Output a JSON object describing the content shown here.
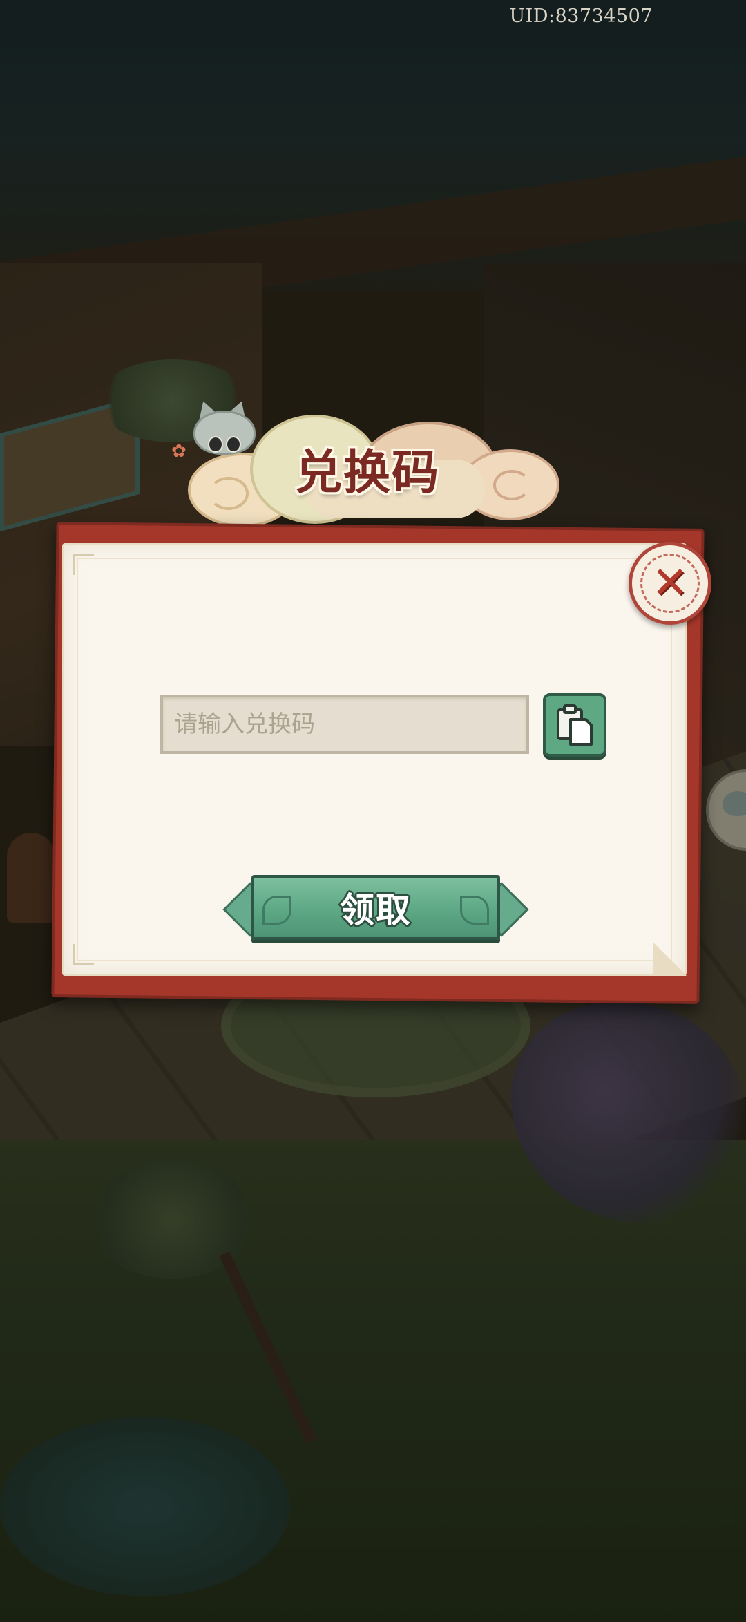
{
  "header": {
    "uid": "UID:83734507"
  },
  "dialog": {
    "title": "兑换码",
    "close_icon": "close-icon",
    "code_input": {
      "placeholder": "请输入兑换码",
      "value": ""
    },
    "paste_icon": "clipboard-paste-icon",
    "claim_button_label": "领取"
  },
  "colors": {
    "frame_red": "#a5372a",
    "paper": "#faf6ee",
    "button_green": "#5ea984",
    "title_text": "#7a2a22"
  }
}
